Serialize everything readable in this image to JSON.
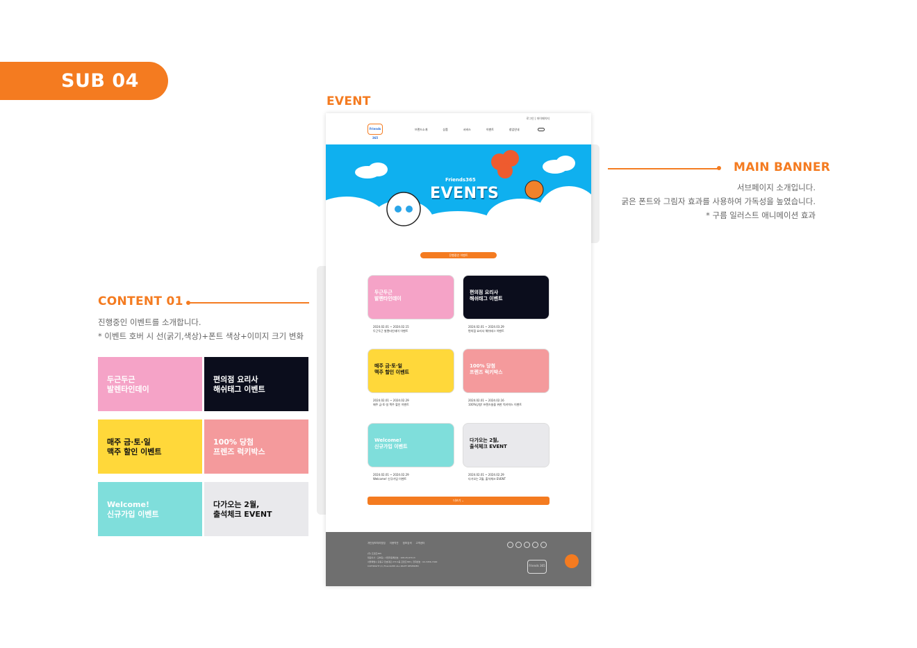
{
  "header": {
    "sub_label": "SUB 04",
    "event_label": "EVENT"
  },
  "main_banner": {
    "title": "MAIN BANNER",
    "lines": [
      "서브페이지 소개입니다.",
      "굵은 폰트와 그림자 효과를 사용하여 가독성을 높였습니다.",
      "* 구름 일러스트 애니메이션 효과"
    ]
  },
  "content01": {
    "title": "CONTENT 01",
    "lines": [
      "진행중인 이벤트를 소개합니다.",
      "* 이벤트 호버 시 선(굵기,색상)+폰트 색상+이미지 크기 변화"
    ]
  },
  "thumbnails": [
    {
      "text": "두근두근\n발렌타인데이",
      "bg": "#f5a3c7",
      "color": "#ffffff"
    },
    {
      "text": "편의점 요리사\n해쉬태그 이벤트",
      "bg": "#0b0d1c",
      "color": "#ffffff"
    },
    {
      "text": "매주 금·토·일\n맥주 할인 이벤트",
      "bg": "#ffd83a",
      "color": "#111111"
    },
    {
      "text": "100% 당첨\n프렌즈 럭키박스",
      "bg": "#f49a9c",
      "color": "#ffffff"
    },
    {
      "text": "Welcome!\n신규가입 이벤트",
      "bg": "#7fdedb",
      "color": "#ffffff"
    },
    {
      "text": "다가오는 2월,\n출석체크 EVENT",
      "bg": "#e9e9ec",
      "color": "#111111"
    }
  ],
  "mockup": {
    "topbar": "로그인  |  마이페이지",
    "logo": "Friends 365",
    "nav": [
      "브랜드소개",
      "상품",
      "서비스",
      "이벤트",
      "창업안내"
    ],
    "banner_sub": "Friends365",
    "banner_title": "EVENTS",
    "tab_button": "진행중인 이벤트",
    "cards": [
      {
        "title": "두근두근\n발렌타인데이",
        "date": "2024.02.01 ~ 2024.02.15",
        "name": "두근두근 발렌타인데이 이벤트",
        "bg": "#f5a3c7",
        "color": "#ffffff"
      },
      {
        "title": "편의점 요리사\n해쉬태그 이벤트",
        "date": "2024.02.01 ~ 2024.03.29",
        "name": "편의점 요리사 해쉬태그 이벤트",
        "bg": "#0b0d1c",
        "color": "#ffffff"
      },
      {
        "title": "매주 금·토·일\n맥주 할인 이벤트",
        "date": "2024.02.01 ~ 2024.02.29",
        "name": "매주 금·토·일 맥주 할인 이벤트",
        "bg": "#ffd83a",
        "color": "#111111"
      },
      {
        "title": "100% 당첨\n프렌즈 럭키박스",
        "date": "2024.02.01 ~ 2024.02.16",
        "name": "100%당첨! 프렌즈들을 위한 럭키박스 이벤트",
        "bg": "#f49a9c",
        "color": "#ffffff"
      },
      {
        "title": "Welcome!\n신규가입 이벤트",
        "date": "2024.02.01 ~ 2024.02.29",
        "name": "Welcome! 신규가입 이벤트",
        "bg": "#7fdedb",
        "color": "#ffffff"
      },
      {
        "title": "다가오는 2월,\n출석체크 EVENT",
        "date": "2024.02.01 ~ 2024.02.29",
        "name": "다가오는 2월, 출석체크 EVENT",
        "bg": "#e9e9ec",
        "color": "#111111"
      }
    ],
    "more_button": "더보기",
    "footer": {
      "links": [
        "개인정보처리방침",
        "이용약관",
        "점포검색",
        "고객센터"
      ],
      "info": [
        "(주) 프렌즈365",
        "대표이사 : 김하림  |  사업자등록번호 : 108-25-67113",
        "서울특별시 강동구 천호대로 270 4층 프렌즈365  |  전화번호 : 02-3456-7400",
        "COPYRIGHT (C) Friends365 ALL RIGHT RESERVED"
      ],
      "logo": "Friends 365"
    }
  },
  "colors": {
    "accent": "#f47b20",
    "banner_sky": "#0fb0ef",
    "footer": "#6f6f6f"
  }
}
